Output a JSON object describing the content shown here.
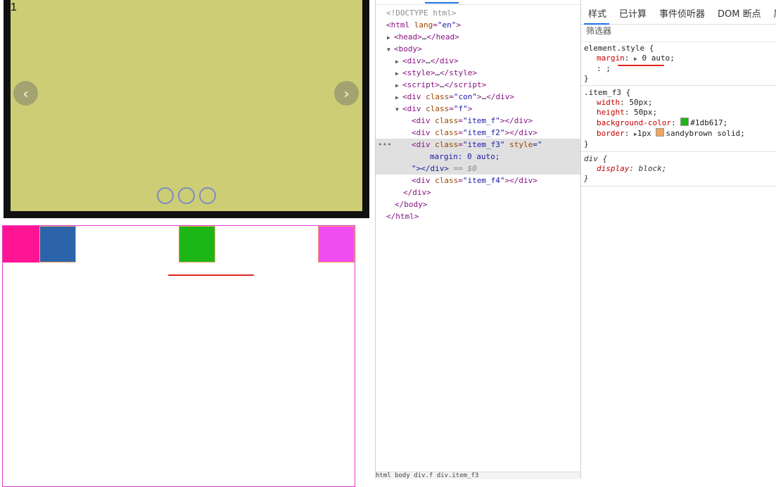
{
  "slider": {
    "slide_number": "1",
    "prev_arrow": "‹",
    "next_arrow": "›",
    "dot_count": 3
  },
  "boxes": [
    {
      "name": "item_f",
      "color": "#ff1493"
    },
    {
      "name": "item_f2",
      "color": "#2c64aa"
    },
    {
      "name": "item_f3",
      "color": "#1db617"
    },
    {
      "name": "item_f4",
      "color": "#f04cf2"
    }
  ],
  "elements_tree": {
    "doctype": "<!DOCTYPE html>",
    "html_open_tag": "html",
    "html_lang_attr": "lang",
    "html_lang_val": "\"en\"",
    "head": "…",
    "body": "body",
    "div1": "…",
    "style": "…",
    "script": "…",
    "div_con_class": "\"con\"",
    "div_f_class": "\"f\"",
    "child1_class": "\"item_f\"",
    "child2_class": "\"item_f2\"",
    "child3_class": "\"item_f3\"",
    "child3_style_attr": "style",
    "child3_style_open": "=\"",
    "child3_style_value": "margin: 0 auto;",
    "child3_close": "\"></div>",
    "child3_ref": "== $0",
    "child4_class": "\"item_f4\"",
    "ellipsis": "•••",
    "breadcrumb": "html  body  div.f  div.item_f3"
  },
  "styles_panel": {
    "tabs": [
      "样式",
      "已计算",
      "事件侦听器",
      "DOM 断点",
      "属"
    ],
    "filter_placeholder": "筛选器",
    "element_style": {
      "selector": "element.style {",
      "prop": "margin",
      "value": "0 auto;",
      "extra": ": ;",
      "close": "}"
    },
    "item_f3_rule": {
      "selector": ".item_f3 {",
      "width": "50px;",
      "height": "50px;",
      "bg": "#1db617;",
      "bg_color": "#1db617",
      "border": "1px",
      "border_color_name": "sandybrown",
      "border_color": "#f4a460",
      "border_style": "solid;",
      "close": "}"
    },
    "ua_rule": {
      "selector": "div {",
      "prop": "display",
      "value": "block;",
      "close": "}"
    }
  }
}
